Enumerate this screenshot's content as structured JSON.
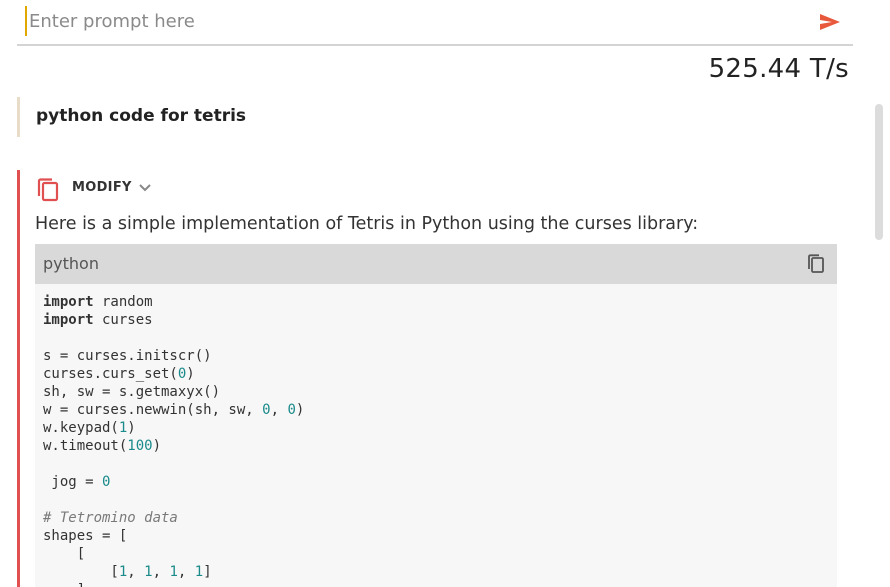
{
  "prompt": {
    "placeholder": "Enter prompt here",
    "value": ""
  },
  "speed": {
    "label": "525.44 T/s"
  },
  "conversation": {
    "user_message": "python code for tetris",
    "assistant": {
      "modify_label": "MODIFY",
      "intro": "Here is a simple implementation of Tetris in Python using the curses library:",
      "code_block": {
        "language": "python",
        "lines": [
          [
            {
              "t": "kw",
              "v": "import"
            },
            {
              "t": "p",
              "v": " random"
            }
          ],
          [
            {
              "t": "kw",
              "v": "import"
            },
            {
              "t": "p",
              "v": " curses"
            }
          ],
          [],
          [
            {
              "t": "p",
              "v": "s = curses.initscr()"
            }
          ],
          [
            {
              "t": "p",
              "v": "curses.curs_set("
            },
            {
              "t": "num",
              "v": "0"
            },
            {
              "t": "p",
              "v": ")"
            }
          ],
          [
            {
              "t": "p",
              "v": "sh, sw = s.getmaxyx()"
            }
          ],
          [
            {
              "t": "p",
              "v": "w = curses.newwin(sh, sw, "
            },
            {
              "t": "num",
              "v": "0"
            },
            {
              "t": "p",
              "v": ", "
            },
            {
              "t": "num",
              "v": "0"
            },
            {
              "t": "p",
              "v": ")"
            }
          ],
          [
            {
              "t": "p",
              "v": "w.keypad("
            },
            {
              "t": "num",
              "v": "1"
            },
            {
              "t": "p",
              "v": ")"
            }
          ],
          [
            {
              "t": "p",
              "v": "w.timeout("
            },
            {
              "t": "num",
              "v": "100"
            },
            {
              "t": "p",
              "v": ")"
            }
          ],
          [],
          [
            {
              "t": "p",
              "v": " jog = "
            },
            {
              "t": "num",
              "v": "0"
            }
          ],
          [],
          [
            {
              "t": "cm",
              "v": "# Tetromino data"
            }
          ],
          [
            {
              "t": "p",
              "v": "shapes = ["
            }
          ],
          [
            {
              "t": "p",
              "v": "    ["
            }
          ],
          [
            {
              "t": "p",
              "v": "        ["
            },
            {
              "t": "num",
              "v": "1"
            },
            {
              "t": "p",
              "v": ", "
            },
            {
              "t": "num",
              "v": "1"
            },
            {
              "t": "p",
              "v": ", "
            },
            {
              "t": "num",
              "v": "1"
            },
            {
              "t": "p",
              "v": ", "
            },
            {
              "t": "num",
              "v": "1"
            },
            {
              "t": "p",
              "v": "]"
            }
          ],
          [
            {
              "t": "p",
              "v": "    ],"
            }
          ]
        ]
      }
    }
  },
  "colors": {
    "send_icon": "#e8593c",
    "assistant_border": "#e05050",
    "user_border": "#e8dcc8",
    "code_header_bg": "#d9d9d9",
    "code_bg": "#f7f7f7",
    "number_token": "#1a8a8a"
  },
  "icons": {
    "send": "send-arrow-icon",
    "copy_message": "copy-icon",
    "modify_chevron": "chevron-down-icon",
    "copy_code": "copy-icon"
  }
}
